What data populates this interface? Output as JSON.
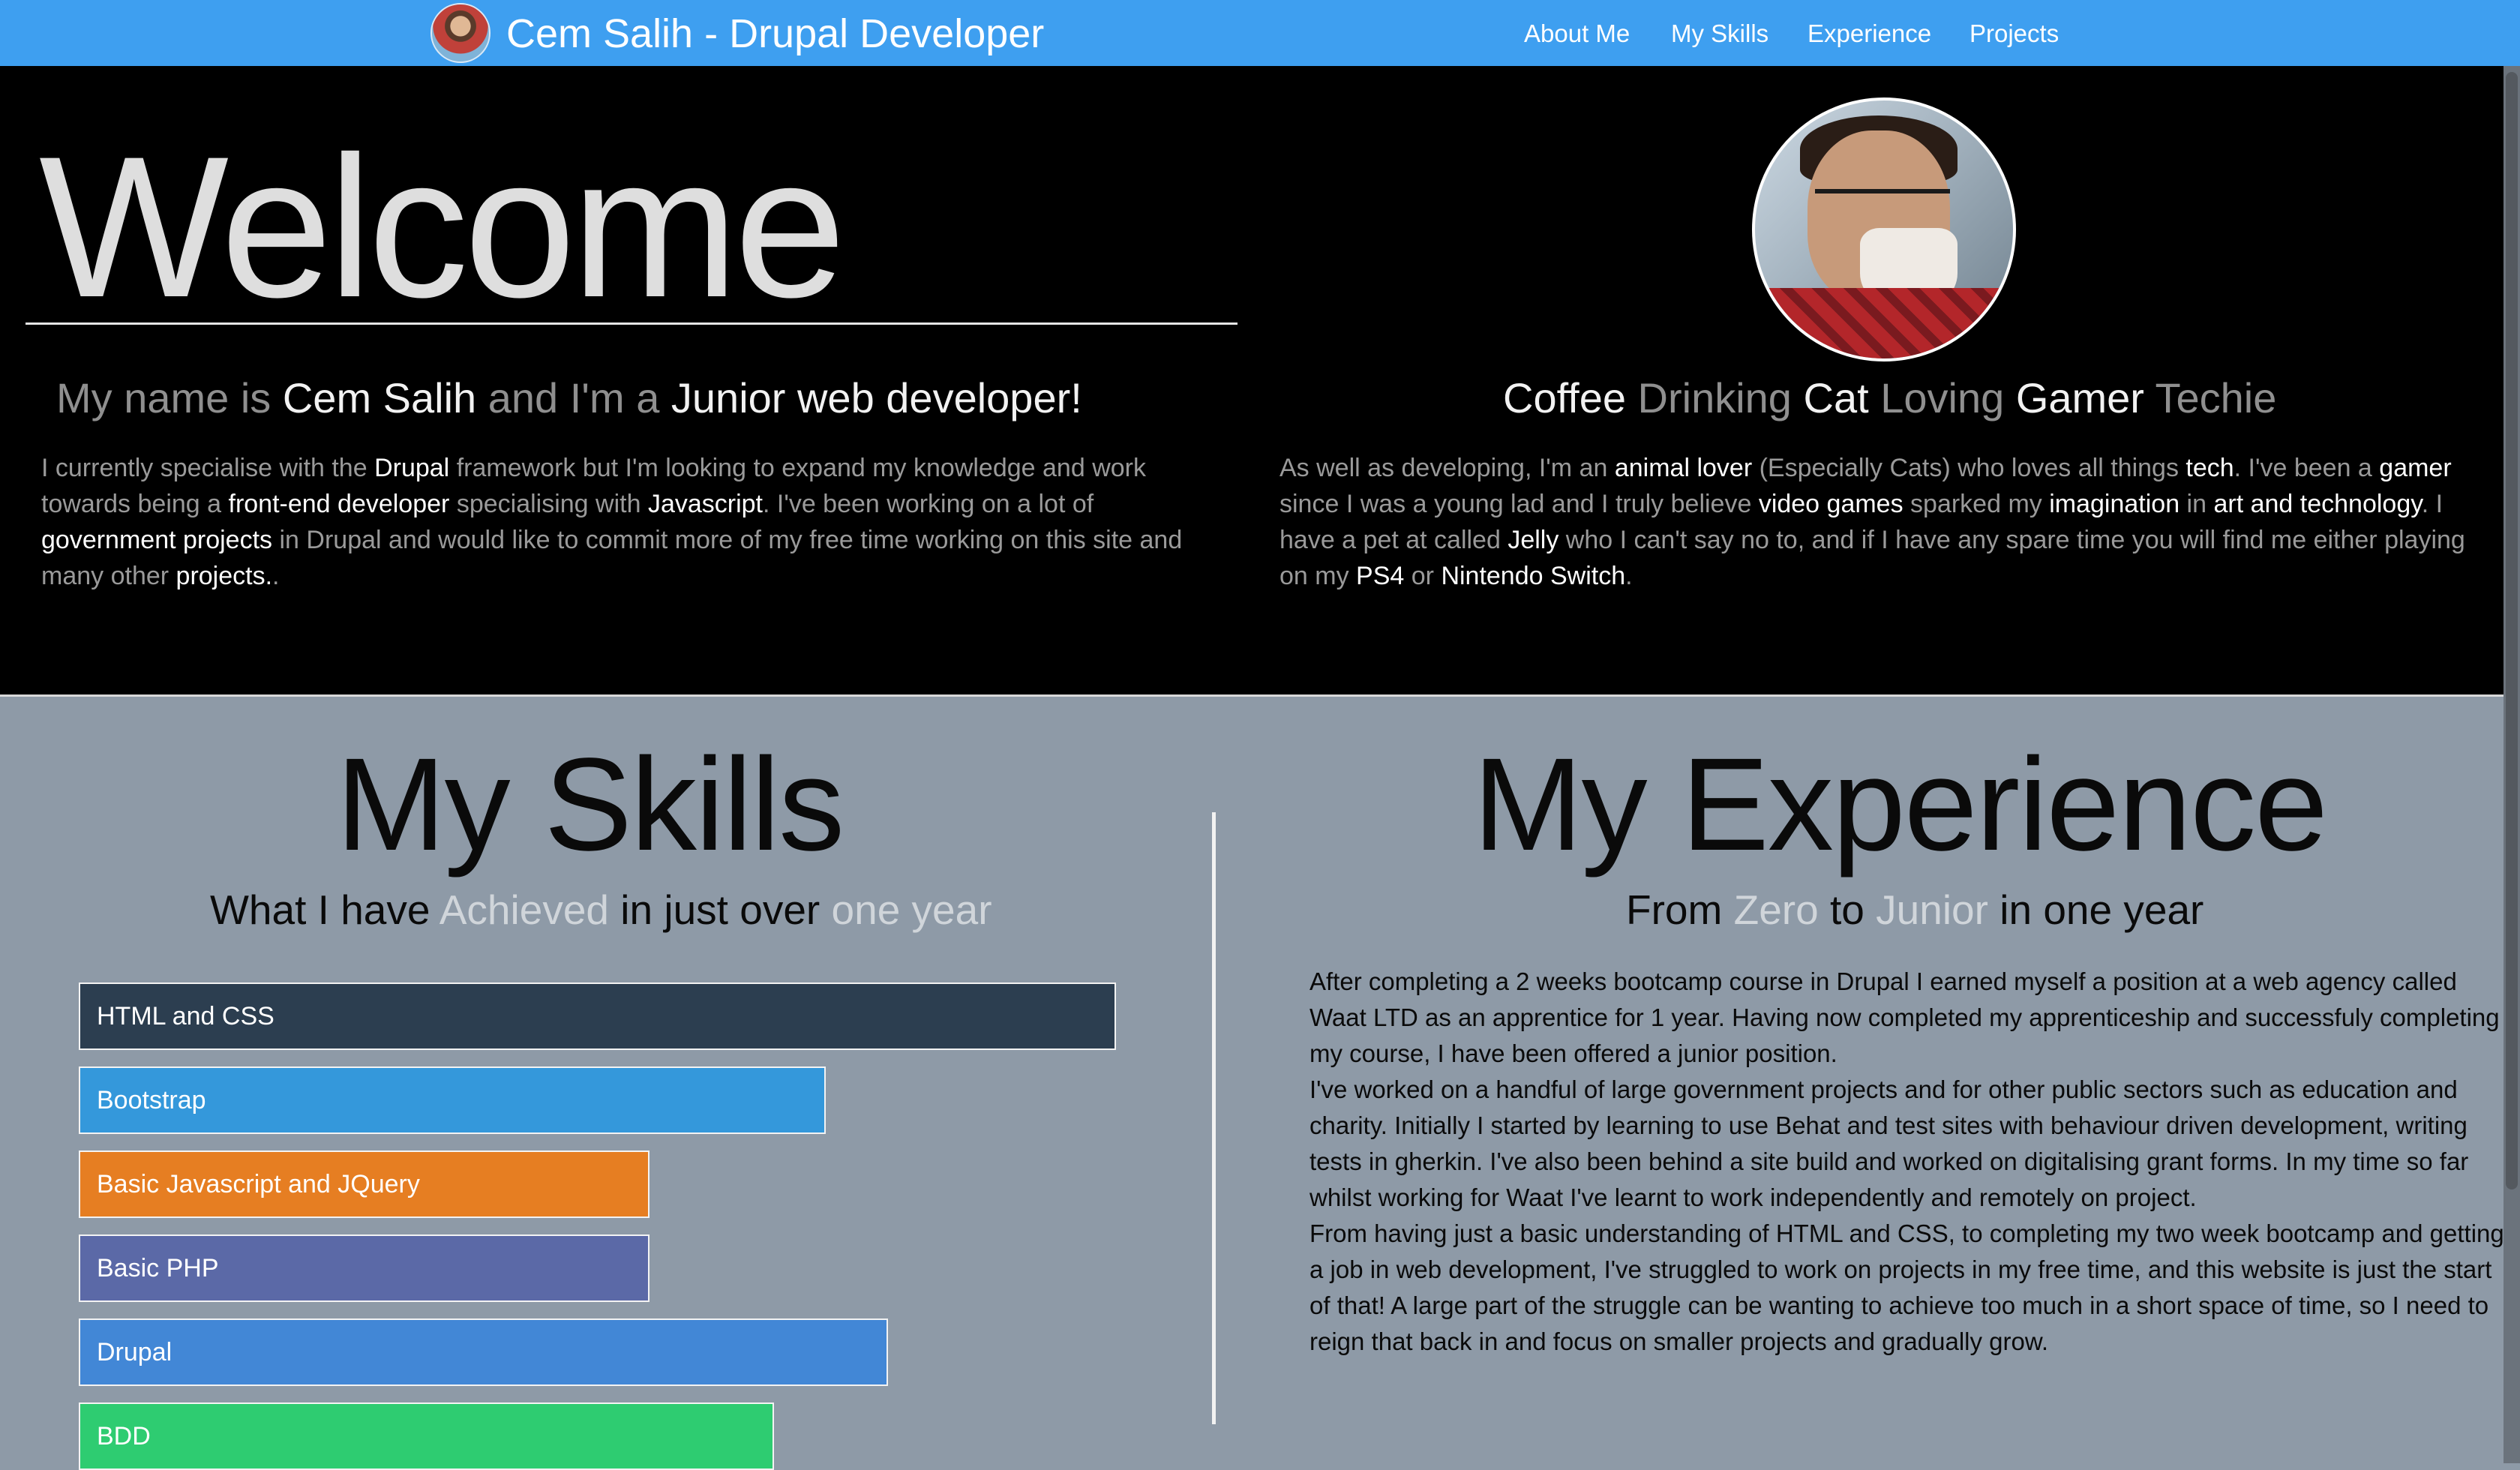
{
  "navbar": {
    "brand_title": "Cem Salih - Drupal Developer",
    "links": [
      {
        "label": "About Me"
      },
      {
        "label": "My Skills"
      },
      {
        "label": "Experience"
      },
      {
        "label": "Projects"
      }
    ]
  },
  "hero": {
    "welcome": "Welcome",
    "intro_heading": {
      "p1": "My name is ",
      "p2": "Cem Salih",
      "p3": " and I'm a ",
      "p4": "Junior web developer!"
    },
    "intro_paragraph": {
      "s1": "I currently specialise with the ",
      "s2": "Drupal",
      "s3": " framework but I'm looking to expand my knowledge and work towards being a ",
      "s4": "front-end developer",
      "s5": " specialising with ",
      "s6": "Javascript",
      "s7": ". I've been working on a lot of ",
      "s8": "government projects",
      "s9": " in Drupal and would like to commit more of my free time working on this site and many other ",
      "s10": "projects.",
      "s11": "."
    },
    "tagline": {
      "w1": "Coffee",
      "w2": " Drinking ",
      "w3": "Cat",
      "w4": " Loving ",
      "w5": "Gamer",
      "w6": " Techie"
    },
    "about_paragraph": {
      "s1": "As well as developing, I'm an ",
      "s2": "animal lover",
      "s3": " (Especially Cats) who loves all things ",
      "s4": "tech",
      "s5": ". I've been a ",
      "s6": "gamer",
      "s7": " since I was a young lad and I truly believe ",
      "s8": "video games",
      "s9": " sparked my ",
      "s10": "imagination",
      "s11": " in ",
      "s12": "art and technology",
      "s13": ". I have a pet at called ",
      "s14": "Jelly",
      "s15": " who I can't say no to, and if I have any spare time you will find me either playing on my ",
      "s16": "PS4",
      "s17": " or ",
      "s18": "Nintendo Switch",
      "s19": "."
    }
  },
  "skills": {
    "title": "My Skills",
    "subtitle": {
      "p1": "What I have ",
      "p2": "Achieved",
      "p3": " in just over ",
      "p4": "one year"
    },
    "bars": [
      {
        "label": "HTML and CSS",
        "color": "#2c3e50",
        "level": 1.0
      },
      {
        "label": "Bootstrap",
        "color": "#3498db",
        "level": 0.72
      },
      {
        "label": "Basic Javascript and JQuery",
        "color": "#e67e22",
        "level": 0.55
      },
      {
        "label": "Basic PHP",
        "color": "#5b69a7",
        "level": 0.55
      },
      {
        "label": "Drupal",
        "color": "#4287d6",
        "level": 0.78
      },
      {
        "label": "BDD",
        "color": "#2ecc71",
        "level": 0.67
      }
    ]
  },
  "experience": {
    "title": "My Experience",
    "subtitle": {
      "p1": "From ",
      "p2": "Zero",
      "p3": " to ",
      "p4": "Junior",
      "p5": " in one year"
    },
    "paragraphs": [
      "After completing a 2 weeks bootcamp course in Drupal I earned myself a position at a web agency called Waat LTD as an apprentice for 1 year. Having now completed my apprenticeship and successfuly completing my course, I have been offered a junior position.",
      "I've worked on a handful of large government projects and for other public sectors such as education and charity. Initially I started by learning to use Behat and test sites with behaviour driven development, writing tests in gherkin. I've also been behind a site build and worked on digitalising grant forms. In my time so far whilst working for Waat I've learnt to work independently and remotely on project.",
      "From having just a basic understanding of HTML and CSS, to completing my two week bootcamp and getting a job in web development, I've struggled to work on projects in my free time, and this website is just the start of that! A large part of the struggle can be wanting to achieve too much in a short space of time, so I need to reign that back in and focus on smaller projects and gradually grow."
    ]
  },
  "colors": {
    "navbar": "#3e9ff0",
    "hero_bg": "#000000",
    "lower_bg": "#8e9aa7"
  }
}
